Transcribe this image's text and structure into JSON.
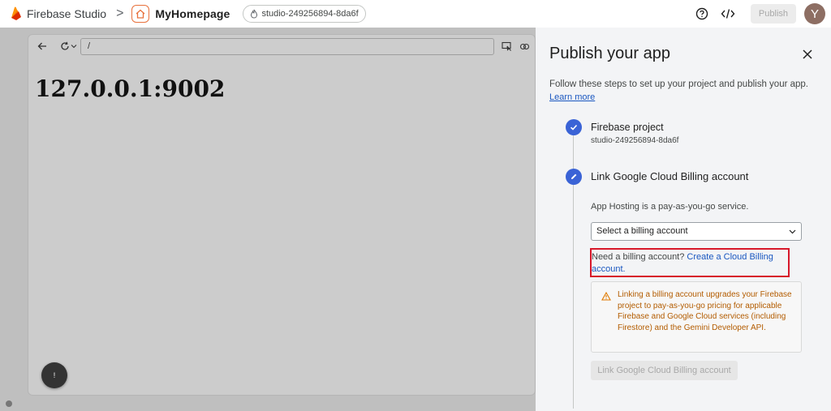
{
  "topbar": {
    "brand_name": "Firebase Studio",
    "breadcrumb_separator": ">",
    "project_name": "MyHomepage",
    "project_id_chip": "studio-249256894-8da6f",
    "publish_label": "Publish",
    "avatar_letter": "Y"
  },
  "preview": {
    "url": "/",
    "heading": "127.0.0.1:9002",
    "fab_label": "!"
  },
  "panel": {
    "title": "Publish your app",
    "description": "Follow these steps to set up your project and publish your app.",
    "learn_more": "Learn more",
    "step1": {
      "title": "Firebase project",
      "subtitle": "studio-249256894-8da6f"
    },
    "step2": {
      "title": "Link Google Cloud Billing account",
      "text": "App Hosting is a pay-as-you-go service.",
      "select_value": "Select a billing account",
      "need_billing_text": "Need a billing account? ",
      "need_billing_link": "Create a Cloud Billing account.",
      "warning": "Linking a billing account upgrades your Firebase project to pay-as-you-go pricing for applicable Firebase and Google Cloud services (including Firestore) and the Gemini Developer API.",
      "link_button": "Link Google Cloud Billing account"
    }
  },
  "colors": {
    "accent_blue": "#3a63d6",
    "link_blue": "#1a57c0",
    "warning_orange": "#b35c00",
    "highlight_red": "#d7182a",
    "panel_bg": "#f3f4f6"
  },
  "icons": [
    "firebase-logo-icon",
    "chevron-right-icon",
    "home-icon",
    "flame-icon",
    "help-icon",
    "code-icon",
    "back-arrow-icon",
    "refresh-icon",
    "chevron-down-icon",
    "inspect-icon",
    "link-icon",
    "close-icon",
    "check-icon",
    "edit-icon",
    "warning-icon"
  ]
}
